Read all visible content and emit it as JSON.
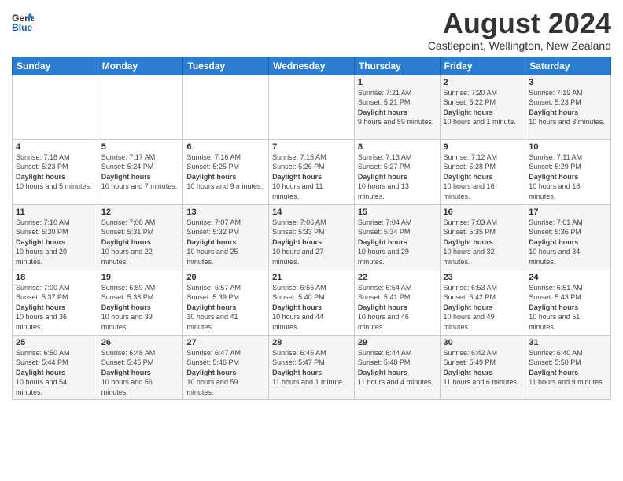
{
  "logo": {
    "general": "General",
    "blue": "Blue"
  },
  "title": "August 2024",
  "location": "Castlepoint, Wellington, New Zealand",
  "days_header": [
    "Sunday",
    "Monday",
    "Tuesday",
    "Wednesday",
    "Thursday",
    "Friday",
    "Saturday"
  ],
  "weeks": [
    [
      {
        "day": "",
        "detail": ""
      },
      {
        "day": "",
        "detail": ""
      },
      {
        "day": "",
        "detail": ""
      },
      {
        "day": "",
        "detail": ""
      },
      {
        "day": "1",
        "sunrise": "7:21 AM",
        "sunset": "5:21 PM",
        "daylight": "9 hours and 59 minutes."
      },
      {
        "day": "2",
        "sunrise": "7:20 AM",
        "sunset": "5:22 PM",
        "daylight": "10 hours and 1 minute."
      },
      {
        "day": "3",
        "sunrise": "7:19 AM",
        "sunset": "5:23 PM",
        "daylight": "10 hours and 3 minutes."
      }
    ],
    [
      {
        "day": "4",
        "sunrise": "7:18 AM",
        "sunset": "5:23 PM",
        "daylight": "10 hours and 5 minutes."
      },
      {
        "day": "5",
        "sunrise": "7:17 AM",
        "sunset": "5:24 PM",
        "daylight": "10 hours and 7 minutes."
      },
      {
        "day": "6",
        "sunrise": "7:16 AM",
        "sunset": "5:25 PM",
        "daylight": "10 hours and 9 minutes."
      },
      {
        "day": "7",
        "sunrise": "7:15 AM",
        "sunset": "5:26 PM",
        "daylight": "10 hours and 11 minutes."
      },
      {
        "day": "8",
        "sunrise": "7:13 AM",
        "sunset": "5:27 PM",
        "daylight": "10 hours and 13 minutes."
      },
      {
        "day": "9",
        "sunrise": "7:12 AM",
        "sunset": "5:28 PM",
        "daylight": "10 hours and 16 minutes."
      },
      {
        "day": "10",
        "sunrise": "7:11 AM",
        "sunset": "5:29 PM",
        "daylight": "10 hours and 18 minutes."
      }
    ],
    [
      {
        "day": "11",
        "sunrise": "7:10 AM",
        "sunset": "5:30 PM",
        "daylight": "10 hours and 20 minutes."
      },
      {
        "day": "12",
        "sunrise": "7:08 AM",
        "sunset": "5:31 PM",
        "daylight": "10 hours and 22 minutes."
      },
      {
        "day": "13",
        "sunrise": "7:07 AM",
        "sunset": "5:32 PM",
        "daylight": "10 hours and 25 minutes."
      },
      {
        "day": "14",
        "sunrise": "7:06 AM",
        "sunset": "5:33 PM",
        "daylight": "10 hours and 27 minutes."
      },
      {
        "day": "15",
        "sunrise": "7:04 AM",
        "sunset": "5:34 PM",
        "daylight": "10 hours and 29 minutes."
      },
      {
        "day": "16",
        "sunrise": "7:03 AM",
        "sunset": "5:35 PM",
        "daylight": "10 hours and 32 minutes."
      },
      {
        "day": "17",
        "sunrise": "7:01 AM",
        "sunset": "5:36 PM",
        "daylight": "10 hours and 34 minutes."
      }
    ],
    [
      {
        "day": "18",
        "sunrise": "7:00 AM",
        "sunset": "5:37 PM",
        "daylight": "10 hours and 36 minutes."
      },
      {
        "day": "19",
        "sunrise": "6:59 AM",
        "sunset": "5:38 PM",
        "daylight": "10 hours and 39 minutes."
      },
      {
        "day": "20",
        "sunrise": "6:57 AM",
        "sunset": "5:39 PM",
        "daylight": "10 hours and 41 minutes."
      },
      {
        "day": "21",
        "sunrise": "6:56 AM",
        "sunset": "5:40 PM",
        "daylight": "10 hours and 44 minutes."
      },
      {
        "day": "22",
        "sunrise": "6:54 AM",
        "sunset": "5:41 PM",
        "daylight": "10 hours and 46 minutes."
      },
      {
        "day": "23",
        "sunrise": "6:53 AM",
        "sunset": "5:42 PM",
        "daylight": "10 hours and 49 minutes."
      },
      {
        "day": "24",
        "sunrise": "6:51 AM",
        "sunset": "5:43 PM",
        "daylight": "10 hours and 51 minutes."
      }
    ],
    [
      {
        "day": "25",
        "sunrise": "6:50 AM",
        "sunset": "5:44 PM",
        "daylight": "10 hours and 54 minutes."
      },
      {
        "day": "26",
        "sunrise": "6:48 AM",
        "sunset": "5:45 PM",
        "daylight": "10 hours and 56 minutes."
      },
      {
        "day": "27",
        "sunrise": "6:47 AM",
        "sunset": "5:46 PM",
        "daylight": "10 hours and 59 minutes."
      },
      {
        "day": "28",
        "sunrise": "6:45 AM",
        "sunset": "5:47 PM",
        "daylight": "11 hours and 1 minute."
      },
      {
        "day": "29",
        "sunrise": "6:44 AM",
        "sunset": "5:48 PM",
        "daylight": "11 hours and 4 minutes."
      },
      {
        "day": "30",
        "sunrise": "6:42 AM",
        "sunset": "5:49 PM",
        "daylight": "11 hours and 6 minutes."
      },
      {
        "day": "31",
        "sunrise": "6:40 AM",
        "sunset": "5:50 PM",
        "daylight": "11 hours and 9 minutes."
      }
    ]
  ],
  "labels": {
    "sunrise": "Sunrise:",
    "sunset": "Sunset:",
    "daylight": "Daylight hours"
  }
}
